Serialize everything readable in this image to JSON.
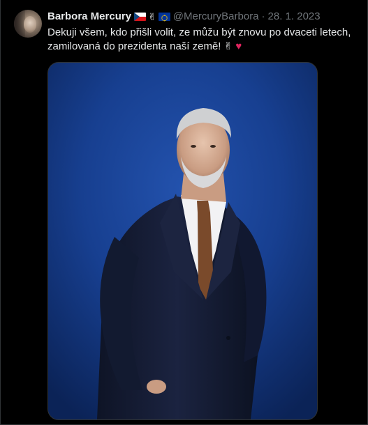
{
  "tweet": {
    "display_name": "Barbora Mercury",
    "handle": "@MercuryBarbora",
    "separator": "·",
    "date": "28. 1. 2023",
    "badges": [
      "czech-flag",
      "victory-hand",
      "eu-flag"
    ],
    "victory_emoji": "✌",
    "text_line1": "Dekuji všem, kdo přišli volit, ze můžu být znovu po dvaceti letech,",
    "text_line2": "zamilovaná do prezidenta naší země!",
    "text_emoji_victory": "✌",
    "text_emoji_heart": "♥"
  },
  "colors": {
    "background": "#000000",
    "text": "#e7e9ea",
    "muted": "#71767b",
    "border": "#2f3336",
    "photo_background": "#163c8a"
  },
  "media": {
    "kind": "photo",
    "subject": "portrait"
  }
}
